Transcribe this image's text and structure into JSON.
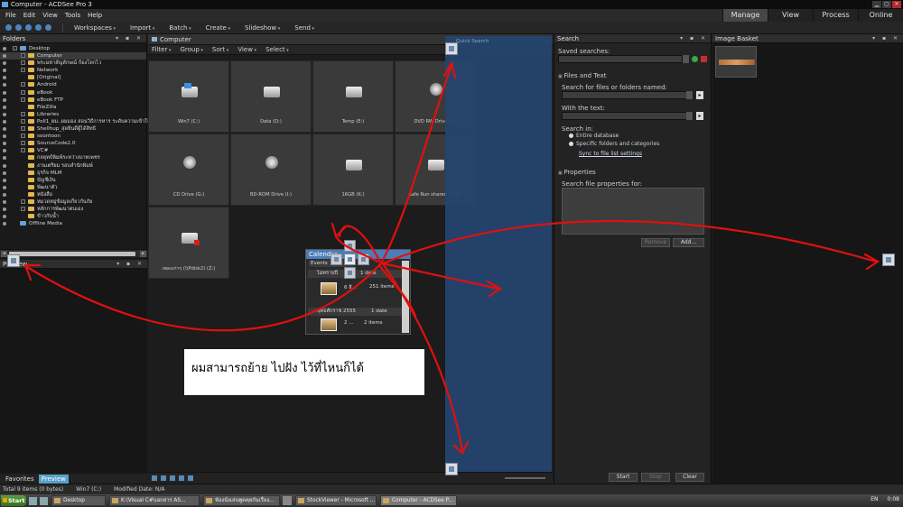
{
  "window": {
    "title": "Computer - ACDSee Pro 3"
  },
  "menu": [
    "File",
    "Edit",
    "View",
    "Tools",
    "Help"
  ],
  "modes": [
    {
      "label": "Manage",
      "active": true
    },
    {
      "label": "View",
      "active": false
    },
    {
      "label": "Process",
      "active": false
    },
    {
      "label": "Online",
      "active": false
    }
  ],
  "toolbar": [
    "Workspaces",
    "Import",
    "Batch",
    "Create",
    "Slideshow",
    "Send"
  ],
  "folders_panel": {
    "title": "Folders",
    "items": [
      {
        "label": "Desktop",
        "level": 0,
        "exp": true,
        "selected": false
      },
      {
        "label": "Computer",
        "level": 1,
        "exp": true,
        "selected": true
      },
      {
        "label": "พระมหาสัญลักษณ์ ก้องโลกไว",
        "level": 1,
        "exp": true,
        "selected": false
      },
      {
        "label": "Network",
        "level": 1,
        "exp": true,
        "selected": false
      },
      {
        "label": "[Original]",
        "level": 1,
        "exp": false,
        "selected": false
      },
      {
        "label": "Android",
        "level": 1,
        "exp": true,
        "selected": false
      },
      {
        "label": "eBook",
        "level": 1,
        "exp": true,
        "selected": false
      },
      {
        "label": "eBook FTP",
        "level": 1,
        "exp": true,
        "selected": false
      },
      {
        "label": "FileZilla",
        "level": 1,
        "exp": false,
        "selected": false
      },
      {
        "label": "Libraries",
        "level": 1,
        "exp": true,
        "selected": false
      },
      {
        "label": "Poll1_ผม..ผมมอง สอนวิธีการหาร ระดับความเข้าใจ",
        "level": 1,
        "exp": true,
        "selected": false
      },
      {
        "label": "Shellhup_สุดยินดีผู้ได้สิทธิ",
        "level": 1,
        "exp": true,
        "selected": false
      },
      {
        "label": "soontoon",
        "level": 1,
        "exp": true,
        "selected": false
      },
      {
        "label": "SourceCode2.0",
        "level": 1,
        "exp": true,
        "selected": false
      },
      {
        "label": "VC#",
        "level": 1,
        "exp": true,
        "selected": false
      },
      {
        "label": "กลยุทธ์พิมพ์ระหว่างบาทเพชร",
        "level": 1,
        "exp": false,
        "selected": false
      },
      {
        "label": "งานเตรียม รอบสำนักพิมพ์",
        "level": 1,
        "exp": false,
        "selected": false
      },
      {
        "label": "ธุรกิจ MLM",
        "level": 1,
        "exp": false,
        "selected": false
      },
      {
        "label": "บัญชีเงิน",
        "level": 1,
        "exp": false,
        "selected": false
      },
      {
        "label": "พัฒนาตัว",
        "level": 1,
        "exp": false,
        "selected": false
      },
      {
        "label": "หนังสือ",
        "level": 1,
        "exp": false,
        "selected": false
      },
      {
        "label": "หมวดหมู่ข้อมูลเกี่ยวกับภัย",
        "level": 1,
        "exp": true,
        "selected": false
      },
      {
        "label": "หลักการพัฒนาตนเอง",
        "level": 1,
        "exp": true,
        "selected": false
      },
      {
        "label": "ข้าวกับน้ำ",
        "level": 1,
        "exp": false,
        "selected": false
      },
      {
        "label": "Offline Media",
        "level": 0,
        "exp": false,
        "selected": false
      }
    ]
  },
  "preview_panel": {
    "title": "Preview"
  },
  "left_tabs": [
    {
      "label": "Favorites",
      "active": false
    },
    {
      "label": "Preview",
      "active": true
    }
  ],
  "browser": {
    "breadcrumb": "Computer",
    "filters": [
      "Filter",
      "Group",
      "Sort",
      "View",
      "Select"
    ],
    "quick_search_placeholder": "Quick Search",
    "tiles": [
      {
        "label": "Win7 (C:)",
        "icon": "windows-drive-icon"
      },
      {
        "label": "Data (D:)",
        "icon": "hard-drive-icon"
      },
      {
        "label": "Temp (E:)",
        "icon": "hard-drive-icon"
      },
      {
        "label": "DVD RW Drive (F:)",
        "icon": "dvd-drive-icon"
      },
      {
        "label": "CD Drive (G:)",
        "icon": "cd-drive-icon"
      },
      {
        "label": "BD-ROM Drive (I:)",
        "icon": "bd-drive-icon"
      },
      {
        "label": "16GB (K:)",
        "icon": "usb-drive-icon"
      },
      {
        "label": "Safe Run shared folder",
        "icon": "shared-folder-icon"
      },
      {
        "label": "เพลงเก่าๆ (\\\\Pdisk2) (Z:)",
        "icon": "network-drive-icon"
      }
    ]
  },
  "calendar_panel": {
    "title": "Calendar",
    "tab": "Events",
    "rows": [
      {
        "label": "ไม่ทราบปี",
        "count": "1 date"
      },
      {
        "label": "6 สิ...",
        "count": "251 items"
      },
      {
        "label": "พุทธศักราช 2555",
        "count": "1 date"
      },
      {
        "label": "2 ...",
        "count": "2 items"
      }
    ]
  },
  "search_panel": {
    "title": "Search",
    "saved_searches_label": "Saved searches:",
    "files_and_text_title": "Files and Text",
    "search_names_label": "Search for files or folders named:",
    "with_text_label": "With the text:",
    "search_in_label": "Search in:",
    "radio_entire": "Entire database",
    "radio_specific": "Specific folders and categories",
    "sync_link": "Sync to file list settings",
    "properties_title": "Properties",
    "props_label": "Search file properties for:",
    "remove_btn": "Remove",
    "add_btn": "Add...",
    "start_btn": "Start",
    "stop_btn": "Stop",
    "clear_btn": "Clear"
  },
  "basket_panel": {
    "title": "Image Basket"
  },
  "status": {
    "total": "Total 9 items (0 bytes)",
    "drive": "Win7 (C:)",
    "modified": "Modified Date: N/A"
  },
  "taskbar": {
    "start": "Start",
    "tasks": [
      {
        "label": "Desktop",
        "active": false
      },
      {
        "label": "K:\\Visual C#\\เอกสาร AS...",
        "active": false
      },
      {
        "label": "ห้องนั่งเล่นพูดคุยกันเรื่อง...",
        "active": false
      },
      {
        "label": "StockViewer - Microsoft ...",
        "active": false
      },
      {
        "label": "Computer - ACDSee P...",
        "active": true
      }
    ],
    "lang": "EN",
    "clock": "0:08"
  },
  "annotation": {
    "note": "ผมสามารถย้าย ไปฝัง ไว้ที่ไหนก็ได้",
    "arrow_color": "#e01010"
  }
}
